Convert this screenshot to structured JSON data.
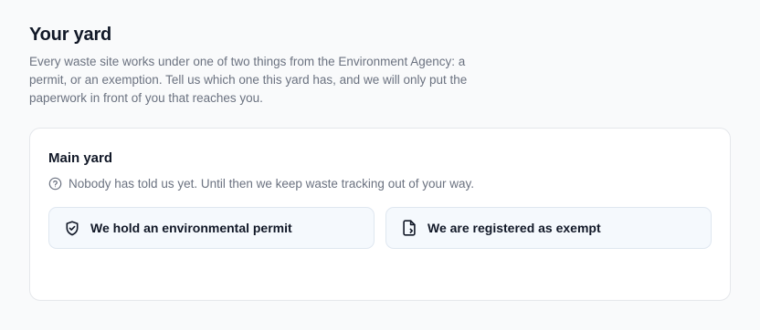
{
  "header": {
    "title": "Your yard",
    "description": "Every waste site works under one of two things from the Environment Agency: a permit, or an exemption. Tell us which one this yard has, and we will only put the paperwork in front of you that reaches you."
  },
  "yard": {
    "name": "Main yard",
    "status_icon": "question-circle-icon",
    "status_text": "Nobody has told us yet. Until then we keep waste tracking out of your way.",
    "options": [
      {
        "icon": "shield-check-icon",
        "label": "We hold an environmental permit"
      },
      {
        "icon": "document-exempt-icon",
        "label": "We are registered as exempt"
      }
    ]
  }
}
